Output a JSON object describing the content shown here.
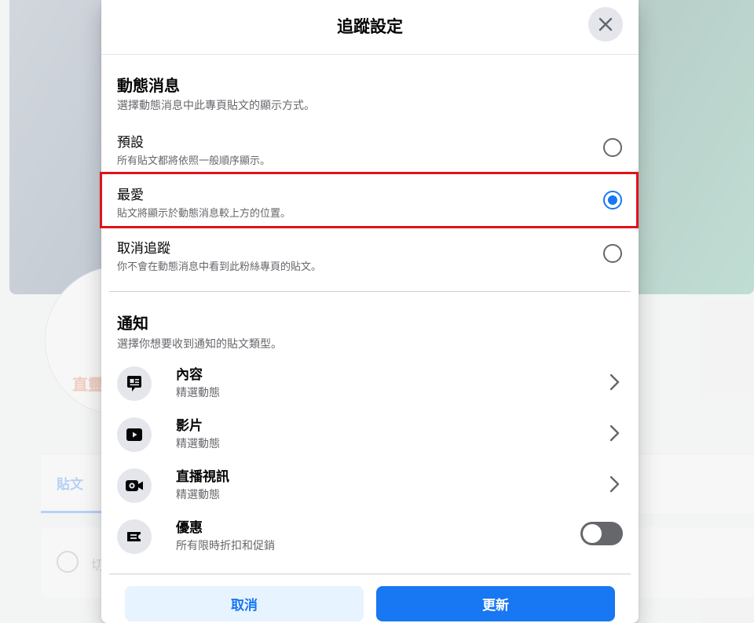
{
  "background": {
    "avatar_logo": "直靈",
    "tab_posts": "貼文",
    "post_placeholder": "切"
  },
  "dialog": {
    "title": "追蹤設定",
    "news_feed": {
      "title": "動態消息",
      "subtitle": "選擇動態消息中此專頁貼文的顯示方式。",
      "options": [
        {
          "label": "預設",
          "description": "所有貼文都將依照一般順序顯示。",
          "selected": false
        },
        {
          "label": "最愛",
          "description": "貼文將顯示於動態消息較上方的位置。",
          "selected": true
        },
        {
          "label": "取消追蹤",
          "description": "你不會在動態消息中看到此粉絲專頁的貼文。",
          "selected": false
        }
      ]
    },
    "notifications": {
      "title": "通知",
      "subtitle": "選擇你想要收到通知的貼文類型。",
      "items": [
        {
          "label": "內容",
          "sublabel": "精選動態",
          "icon": "chat-bubble-icon"
        },
        {
          "label": "影片",
          "sublabel": "精選動態",
          "icon": "video-play-icon"
        },
        {
          "label": "直播視訊",
          "sublabel": "精選動態",
          "icon": "live-video-icon"
        },
        {
          "label": "優惠",
          "sublabel": "所有限時折扣和促銷",
          "icon": "coupon-icon",
          "toggle_on": false
        }
      ]
    },
    "buttons": {
      "cancel": "取消",
      "update": "更新"
    }
  },
  "colors": {
    "accent": "#1877f2",
    "highlight_border": "#e0131c",
    "secondary_text": "#65676b"
  }
}
